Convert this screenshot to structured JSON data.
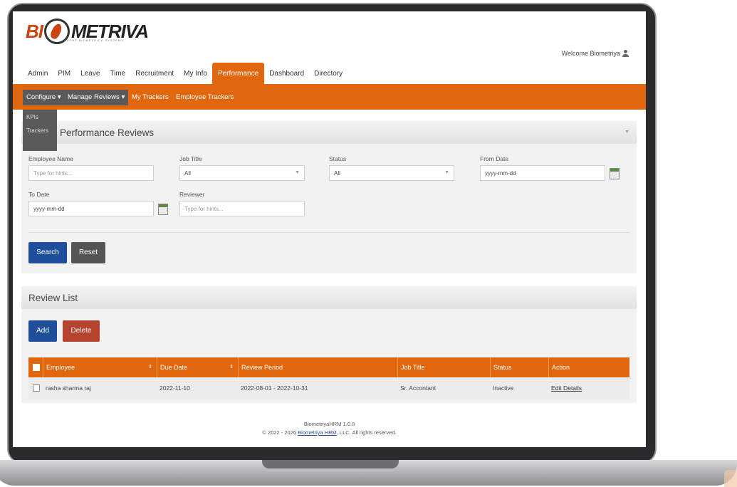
{
  "brand": {
    "logo_left": "BI",
    "logo_right": "METRIVA",
    "tagline": "SPORT BIOMETRICS SYSTEMS"
  },
  "header": {
    "welcome": "Welcome Biometriya"
  },
  "main_menu": [
    "Admin",
    "PIM",
    "Leave",
    "Time",
    "Recruitment",
    "My Info",
    "Performance",
    "Dashboard",
    "Directory"
  ],
  "active_menu": "Performance",
  "sub_menu": {
    "configure": "Configure ▾",
    "manage_reviews": "Manage Reviews ▾",
    "my_trackers": "My Trackers",
    "employee_trackers": "Employee Trackers"
  },
  "configure_dropdown": [
    "KPIs",
    "Trackers"
  ],
  "search_panel": {
    "title": "Performance Reviews",
    "employee_name_label": "Employee Name",
    "employee_name_placeholder": "Type for hints...",
    "job_title_label": "Job Title",
    "job_title_value": "All",
    "status_label": "Status",
    "status_value": "All",
    "from_date_label": "From Date",
    "from_date_placeholder": "yyyy-mm-dd",
    "to_date_label": "To Date",
    "to_date_placeholder": "yyyy-mm-dd",
    "reviewer_label": "Reviewer",
    "reviewer_placeholder": "Type for hints...",
    "search_button": "Search",
    "reset_button": "Reset"
  },
  "review_list": {
    "title": "Review List",
    "add_button": "Add",
    "delete_button": "Delete",
    "columns": [
      "Employee",
      "Due Date",
      "Review Period",
      "Job Title",
      "Status",
      "Action"
    ],
    "rows": [
      {
        "employee": "rasha sharma raj",
        "due_date": "2022-11-10",
        "review_period": "2022-08-01 - 2022-10-31",
        "job_title": "Sr. Accontant",
        "status": "Inactive",
        "action": "Edit Details"
      }
    ]
  },
  "footer": {
    "version": "BiometriyaHRM 1.0.0",
    "copyright_prefix": "© 2022 - 2026",
    "copyright_link": "Biometriya HRM",
    "copyright_suffix": ", LLC. All rights reserved."
  },
  "colors": {
    "accent": "#e0670e",
    "primary_button": "#1f4f9a",
    "danger_button": "#b5432e",
    "neutral_button": "#555555"
  }
}
